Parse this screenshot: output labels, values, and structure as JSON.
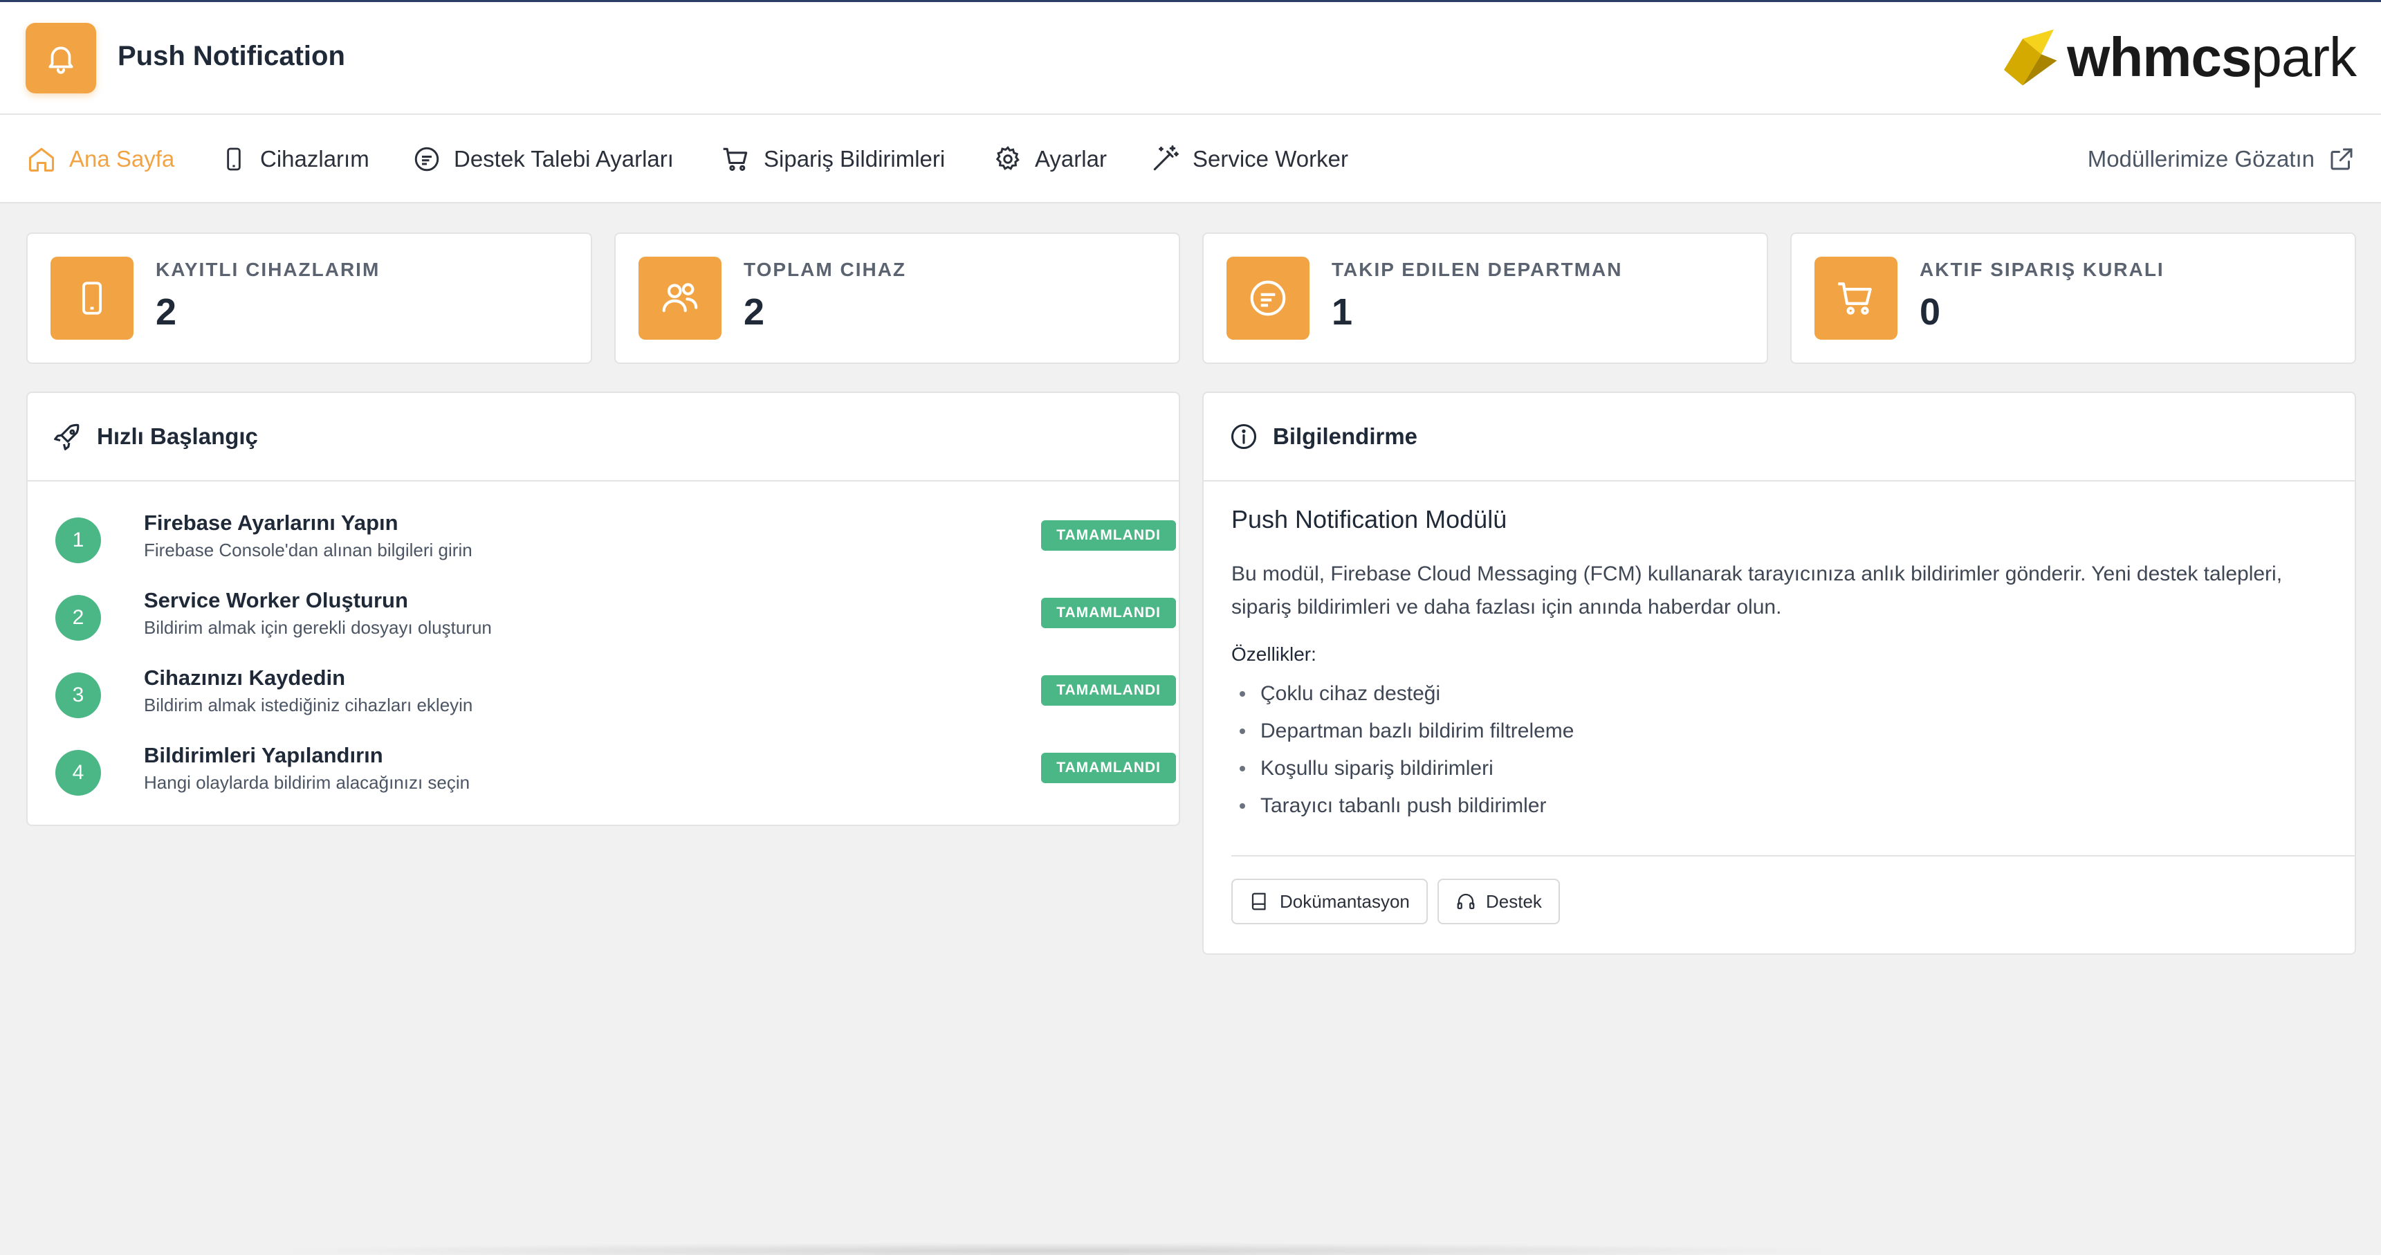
{
  "app": {
    "title": "Push Notification",
    "brand_bold": "whmcs",
    "brand_light": "park"
  },
  "nav": {
    "items": [
      {
        "label": "Ana Sayfa",
        "icon": "home-icon",
        "active": true
      },
      {
        "label": "Cihazlarım",
        "icon": "phone-icon"
      },
      {
        "label": "Destek Talebi Ayarları",
        "icon": "chat-icon"
      },
      {
        "label": "Sipariş Bildirimleri",
        "icon": "cart-icon"
      },
      {
        "label": "Ayarlar",
        "icon": "gear-icon"
      },
      {
        "label": "Service Worker",
        "icon": "wand-icon"
      }
    ],
    "right_link": "Modüllerimize Gözatın"
  },
  "stats": [
    {
      "label": "KAYITLI CIHAZLARIM",
      "value": "2",
      "icon": "phone-icon"
    },
    {
      "label": "TOPLAM CIHAZ",
      "value": "2",
      "icon": "users-icon"
    },
    {
      "label": "TAKIP EDILEN DEPARTMAN",
      "value": "1",
      "icon": "chat-icon"
    },
    {
      "label": "AKTIF SIPARIŞ KURALI",
      "value": "0",
      "icon": "cart-icon"
    }
  ],
  "quickstart": {
    "title": "Hızlı Başlangıç",
    "steps": [
      {
        "num": "1",
        "title": "Firebase Ayarlarını Yapın",
        "desc": "Firebase Console'dan alınan bilgileri girin",
        "status": "TAMAMLANDI"
      },
      {
        "num": "2",
        "title": "Service Worker Oluşturun",
        "desc": "Bildirim almak için gerekli dosyayı oluşturun",
        "status": "TAMAMLANDI"
      },
      {
        "num": "3",
        "title": "Cihazınızı Kaydedin",
        "desc": "Bildirim almak istediğiniz cihazları ekleyin",
        "status": "TAMAMLANDI"
      },
      {
        "num": "4",
        "title": "Bildirimleri Yapılandırın",
        "desc": "Hangi olaylarda bildirim alacağınızı seçin",
        "status": "TAMAMLANDI"
      }
    ]
  },
  "info": {
    "title": "Bilgilendirme",
    "module_title": "Push Notification Modülü",
    "description": "Bu modül, Firebase Cloud Messaging (FCM) kullanarak tarayıcınıza anlık bildirimler gönderir. Yeni destek talepleri, sipariş bildirimleri ve daha fazlası için anında haberdar olun.",
    "features_label": "Özellikler:",
    "features": [
      "Çoklu cihaz desteği",
      "Departman bazlı bildirim filtreleme",
      "Koşullu sipariş bildirimleri",
      "Tarayıcı tabanlı push bildirimler"
    ],
    "buttons": {
      "docs": "Dokümantasyon",
      "support": "Destek"
    }
  },
  "colors": {
    "accent": "#f2a444",
    "success": "#4bb686",
    "header_line": "#2c3e66"
  }
}
